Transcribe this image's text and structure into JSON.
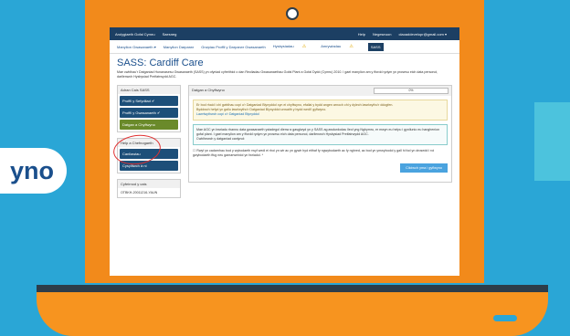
{
  "pill_text": "yno",
  "topbar": {
    "brand": "Arolygiaeth Gofal Cymru",
    "lang": "Saesneg",
    "help": "Help",
    "register": "Negeseuon",
    "email": "claoaddevelopr@gmail.com ▾"
  },
  "nav": {
    "items": [
      "Manylion Gwasanaeth ▾",
      "Manylion Darparwr",
      "Grwpiau Proffil y Darparwr Gwasanaeth",
      "Hysbysiadau",
      "Amrywiadau",
      "SASS"
    ],
    "warn": "⚠"
  },
  "title": "SASS: Cardiff Care",
  "intro": "Mae cwblhau'r Datganiad Hunanasesu Gwasanaeth (SASS) yn ofyniad cyfreithiol o dan Reoliadau Gwasanaethau Gofal Plant a Gofal Dydd (Cymru) 2010. I gael manylion am y ffordd rydym yn prosesu eich data personol, darllenwch Hysbysiad Preifatrwydd AGC.",
  "left": {
    "panel1_title": "Adran Cais SASS",
    "items": [
      "Proffil y Sefydliad ✔",
      "Proffil y Gwasanaeth ✔",
      "Datgan a Chyflwyno"
    ],
    "panel2_title": "Help a Chefnogaeth",
    "help_items": [
      "Canllawiau",
      "Cysylltwch â ni"
    ],
    "panel3_title": "Cyfeirnod y cais",
    "ref": "OTBKH-20011216-YAUN"
  },
  "right": {
    "header": "Datgan a Chyflwyno",
    "progress": "0%",
    "alert1": "Er bod rhaid i chi gwblhau copi o'r Datganiad Blynyddol cyn ei chyflwyno, efallai y bydd angen arnoch chi y dylech lawrlwytho'r ddogfen.",
    "alert2": "Byddwch hefyd yn gallu lawrlwytho'r Datganiad Blynyddol unwaith y bydd wedi'i gyflwyno.",
    "alert_link": "Lawrlwythwch copi o'r Datganiad Blynyddol",
    "info": "Mae AGC yn bwriadu rhannu data gwasanaeth ystadegol dienw a gasglwyd yn y SASS ag awdurdodau lleol yng Nghymru, er mwyn eu helpu i gynllunio eu hanghenion gofal plant. I gael manylion am y ffordd rydym yn prosesu eich data personol, darllenwch Hysbysiad Preifatrwydd AGC.",
    "info_link": "Cwblhewch y datganiad canlynol:",
    "check": "Rwyf yn cadarnhau bod y wybodaeth rwyf wedi ei rhoi yn wir ac yn gywir hyd eithaf fy ngwybodaeth ac fy nghred, ac bod yn ymwybodol y gall hi fod yn drosedd i roi gwybodaeth ffug neu gamarweiniol yn fwriadol. *",
    "button": "Cliciwch yma i gyflwyno"
  }
}
